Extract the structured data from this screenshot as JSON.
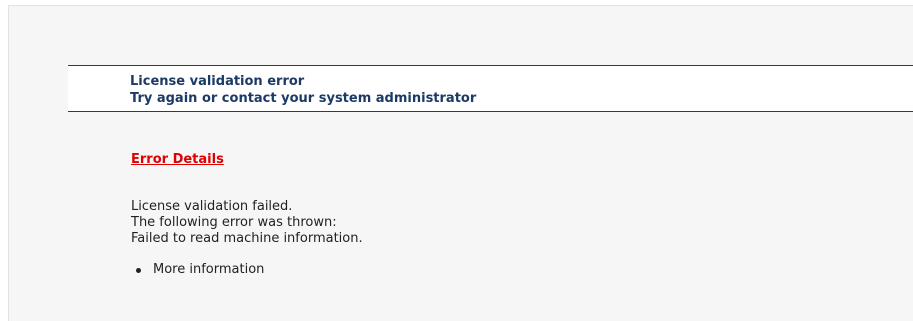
{
  "header": {
    "title": "License validation error",
    "subtitle": "Try again or contact your system administrator"
  },
  "error_details": {
    "link_label": "Error Details",
    "lines": [
      "License validation failed.",
      "The following error was thrown:",
      "Failed to read machine information."
    ],
    "more_info_label": "More information"
  },
  "colors": {
    "header_text": "#1c3a66",
    "header_rule": "#1c3f6e",
    "error_link": "#e00000",
    "panel_background": "#f6f6f6"
  }
}
